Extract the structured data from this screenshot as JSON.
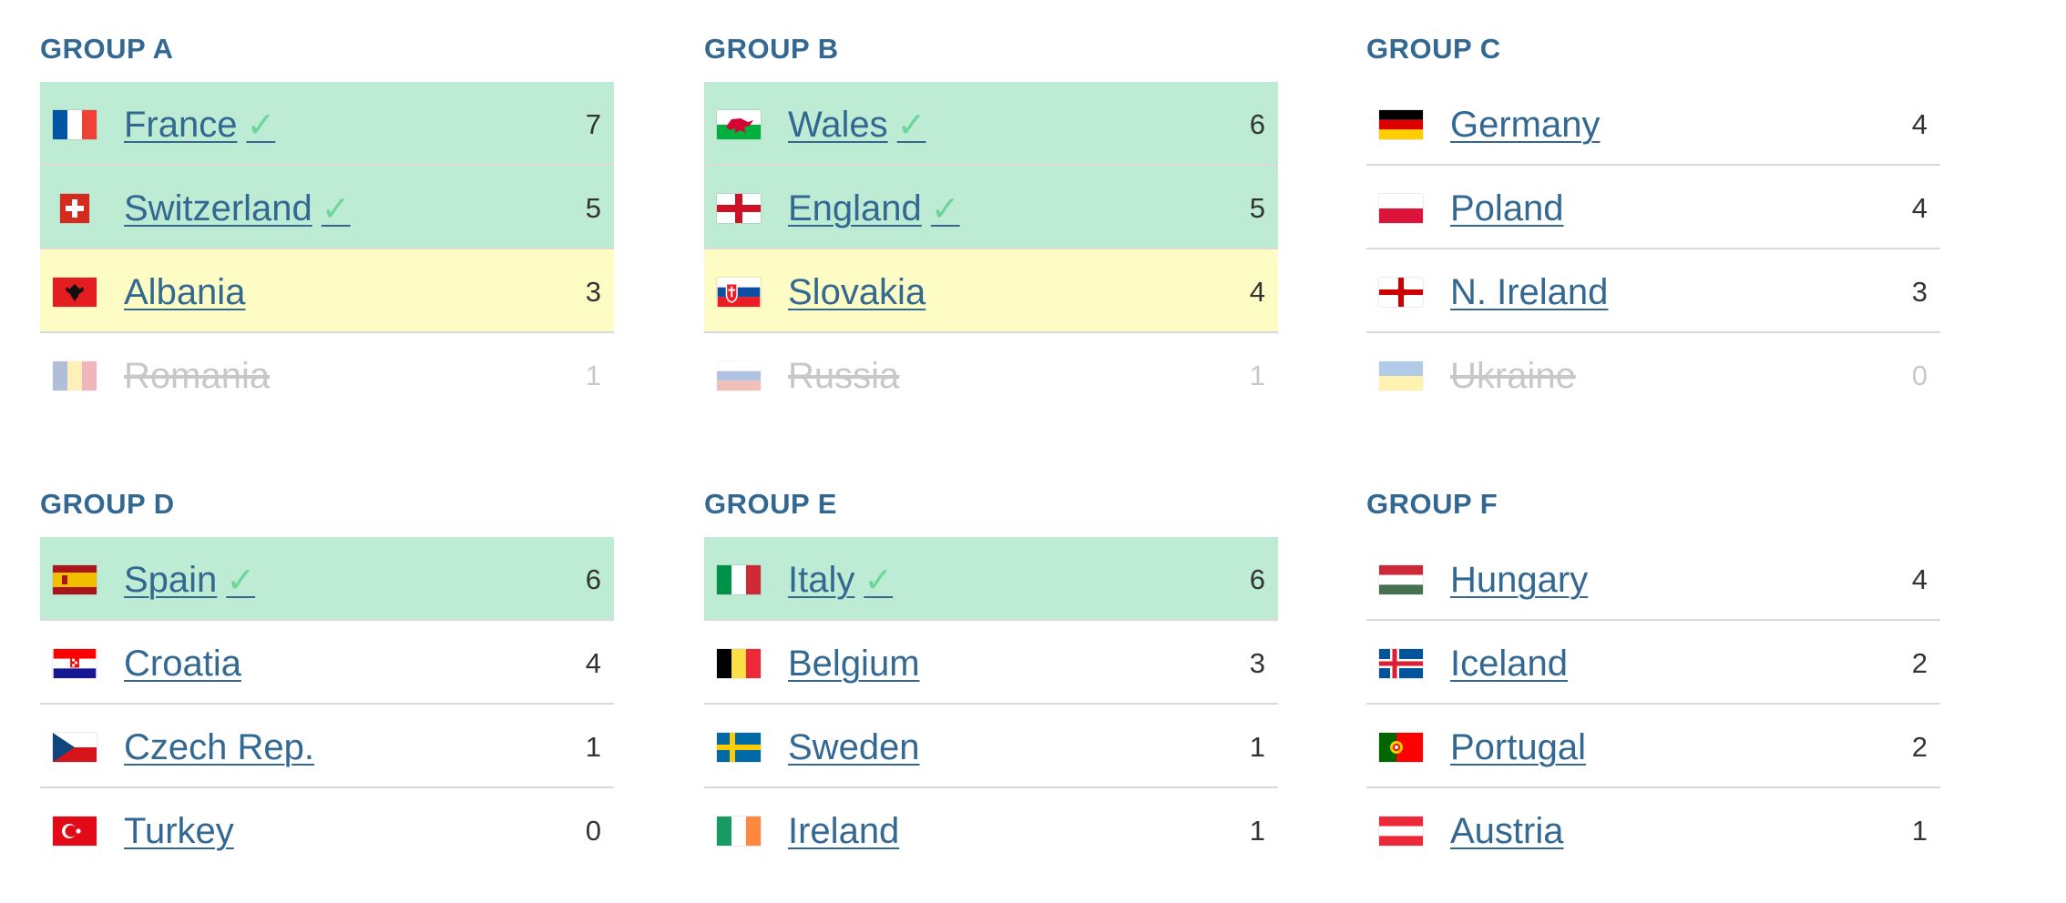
{
  "colors": {
    "title": "#326891",
    "qualified_bg": "#bdebd3",
    "third_bg": "#fefcc5",
    "check": "#6fd69a",
    "eliminated": "#c8c8c8"
  },
  "check_mark": "✓",
  "groups": [
    {
      "title": "GROUP A",
      "teams": [
        {
          "name": "France",
          "points": "7",
          "status": "qualified",
          "flag": "france-flag-icon"
        },
        {
          "name": "Switzerland",
          "points": "5",
          "status": "qualified",
          "flag": "switzerland-flag-icon"
        },
        {
          "name": "Albania",
          "points": "3",
          "status": "third",
          "flag": "albania-flag-icon"
        },
        {
          "name": "Romania",
          "points": "1",
          "status": "eliminated",
          "flag": "romania-flag-icon"
        }
      ]
    },
    {
      "title": "GROUP B",
      "teams": [
        {
          "name": "Wales",
          "points": "6",
          "status": "qualified",
          "flag": "wales-flag-icon"
        },
        {
          "name": "England",
          "points": "5",
          "status": "qualified",
          "flag": "england-flag-icon"
        },
        {
          "name": "Slovakia",
          "points": "4",
          "status": "third",
          "flag": "slovakia-flag-icon"
        },
        {
          "name": "Russia",
          "points": "1",
          "status": "eliminated",
          "flag": "russia-flag-icon"
        }
      ]
    },
    {
      "title": "GROUP C",
      "teams": [
        {
          "name": "Germany",
          "points": "4",
          "status": "normal",
          "flag": "germany-flag-icon"
        },
        {
          "name": "Poland",
          "points": "4",
          "status": "normal",
          "flag": "poland-flag-icon"
        },
        {
          "name": "N. Ireland",
          "points": "3",
          "status": "normal",
          "flag": "northern-ireland-flag-icon"
        },
        {
          "name": "Ukraine",
          "points": "0",
          "status": "eliminated",
          "flag": "ukraine-flag-icon"
        }
      ]
    },
    {
      "title": "GROUP D",
      "teams": [
        {
          "name": "Spain",
          "points": "6",
          "status": "qualified",
          "flag": "spain-flag-icon"
        },
        {
          "name": "Croatia",
          "points": "4",
          "status": "normal",
          "flag": "croatia-flag-icon"
        },
        {
          "name": "Czech Rep.",
          "points": "1",
          "status": "normal",
          "flag": "czech-flag-icon"
        },
        {
          "name": "Turkey",
          "points": "0",
          "status": "normal",
          "flag": "turkey-flag-icon"
        }
      ]
    },
    {
      "title": "GROUP E",
      "teams": [
        {
          "name": "Italy",
          "points": "6",
          "status": "qualified",
          "flag": "italy-flag-icon"
        },
        {
          "name": "Belgium",
          "points": "3",
          "status": "normal",
          "flag": "belgium-flag-icon"
        },
        {
          "name": "Sweden",
          "points": "1",
          "status": "normal",
          "flag": "sweden-flag-icon"
        },
        {
          "name": "Ireland",
          "points": "1",
          "status": "normal",
          "flag": "ireland-flag-icon"
        }
      ]
    },
    {
      "title": "GROUP F",
      "teams": [
        {
          "name": "Hungary",
          "points": "4",
          "status": "normal",
          "flag": "hungary-flag-icon"
        },
        {
          "name": "Iceland",
          "points": "2",
          "status": "normal",
          "flag": "iceland-flag-icon"
        },
        {
          "name": "Portugal",
          "points": "2",
          "status": "normal",
          "flag": "portugal-flag-icon"
        },
        {
          "name": "Austria",
          "points": "1",
          "status": "normal",
          "flag": "austria-flag-icon"
        }
      ]
    }
  ]
}
